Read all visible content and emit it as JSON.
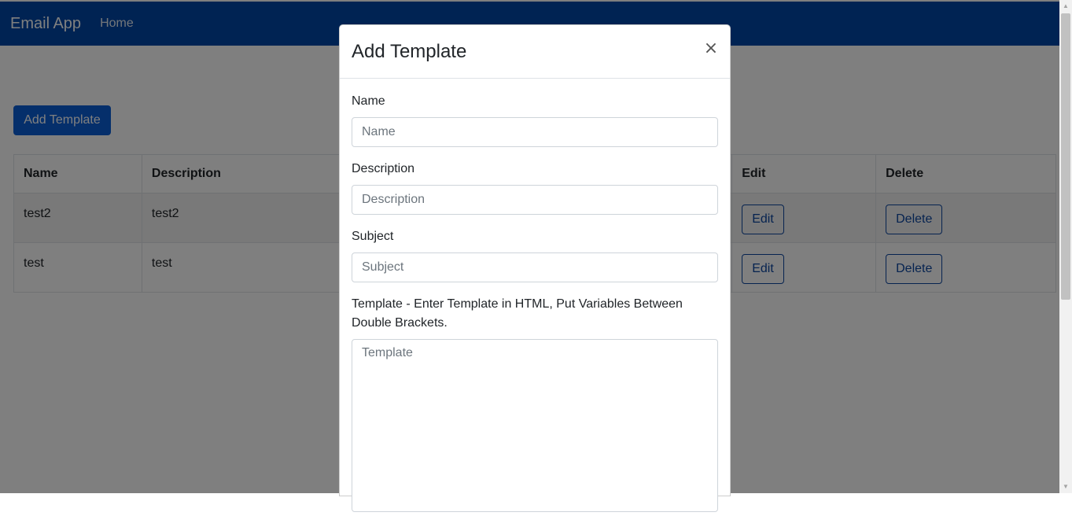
{
  "navbar": {
    "brand": "Email App",
    "home_link": "Home"
  },
  "page": {
    "add_button": "Add Template"
  },
  "table": {
    "headers": {
      "name": "Name",
      "description": "Description",
      "edit": "Edit",
      "delete": "Delete"
    },
    "rows": [
      {
        "name": "test2",
        "description": "test2",
        "edit_label": "Edit",
        "delete_label": "Delete"
      },
      {
        "name": "test",
        "description": "test",
        "edit_label": "Edit",
        "delete_label": "Delete"
      }
    ]
  },
  "modal": {
    "title": "Add Template",
    "close_glyph": "×",
    "fields": {
      "name": {
        "label": "Name",
        "placeholder": "Name",
        "value": ""
      },
      "description": {
        "label": "Description",
        "placeholder": "Description",
        "value": ""
      },
      "subject": {
        "label": "Subject",
        "placeholder": "Subject",
        "value": ""
      },
      "template": {
        "label": "Template - Enter Template in HTML, Put Variables Between Double Brackets.",
        "placeholder": "Template",
        "value": ""
      }
    }
  },
  "icons": {
    "close": "close-icon",
    "scroll_up": "scroll-up-icon",
    "scroll_down": "scroll-down-icon"
  },
  "colors": {
    "navbar": "#0047a6",
    "primary": "#0b5ed7",
    "outline": "#0d47a1"
  }
}
